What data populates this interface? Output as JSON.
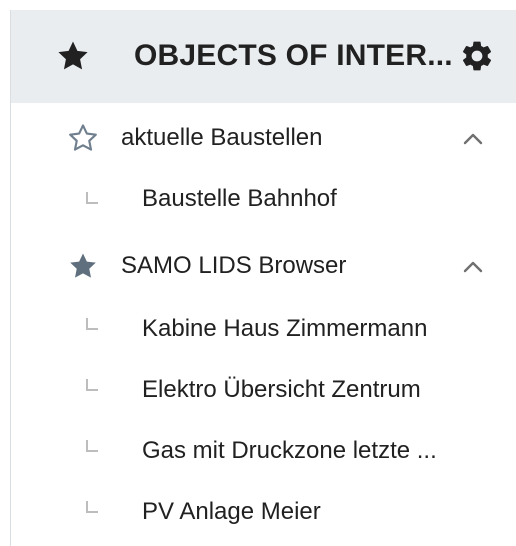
{
  "header": {
    "title": "OBJECTS OF INTER...",
    "star_icon": "star-filled-icon",
    "settings_icon": "gear-icon"
  },
  "groups": [
    {
      "label": "aktuelle Baustellen",
      "icon": "star-outline-icon",
      "expanded": true,
      "items": [
        {
          "label": "Baustelle Bahnhof"
        }
      ]
    },
    {
      "label": "SAMO LIDS Browser",
      "icon": "star-filled-icon",
      "expanded": true,
      "items": [
        {
          "label": "Kabine Haus Zimmermann"
        },
        {
          "label": "Elektro Übersicht Zentrum"
        },
        {
          "label": "Gas mit Druckzone letzte ..."
        },
        {
          "label": "PV Anlage Meier"
        }
      ]
    }
  ],
  "colors": {
    "header_bg": "#e9edf0",
    "text": "#212121",
    "icon_dark": "#212121",
    "icon_filled_grey": "#5f6f7e",
    "icon_outline_grey": "#6f7f8e",
    "chevron": "#707070",
    "tree_line": "#bdbdbd"
  }
}
